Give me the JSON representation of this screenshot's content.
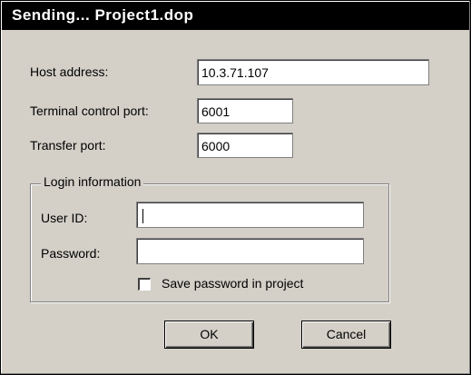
{
  "dialog": {
    "title": "Sending... Project1.dop"
  },
  "connection": {
    "host_label": "Host address:",
    "host_value": "10.3.71.107",
    "terminal_port_label": "Terminal control port:",
    "terminal_port_value": "6001",
    "transfer_port_label": "Transfer port:",
    "transfer_port_value": "6000"
  },
  "login": {
    "group_label": "Login information",
    "user_id_label": "User ID:",
    "user_id_value": "",
    "password_label": "Password:",
    "password_value": "",
    "save_password_label": "Save password in project",
    "save_password_checked": false
  },
  "buttons": {
    "ok_label": "OK",
    "cancel_label": "Cancel"
  },
  "colors": {
    "dialog_face": "#d4d0c8",
    "titlebar": "#000000",
    "title_text": "#ffffff"
  }
}
